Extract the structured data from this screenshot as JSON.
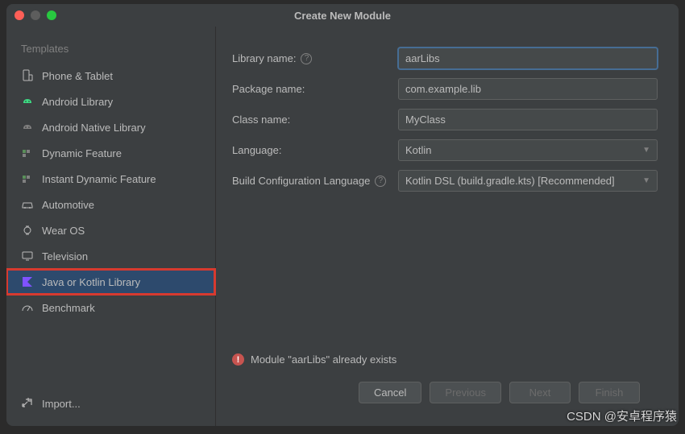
{
  "title": "Create New Module",
  "sidebar": {
    "header": "Templates",
    "items": [
      {
        "label": "Phone & Tablet",
        "icon": "phone"
      },
      {
        "label": "Android Library",
        "icon": "android"
      },
      {
        "label": "Android Native Library",
        "icon": "native"
      },
      {
        "label": "Dynamic Feature",
        "icon": "dynamic"
      },
      {
        "label": "Instant Dynamic Feature",
        "icon": "instant"
      },
      {
        "label": "Automotive",
        "icon": "car"
      },
      {
        "label": "Wear OS",
        "icon": "watch"
      },
      {
        "label": "Television",
        "icon": "tv"
      },
      {
        "label": "Java or Kotlin Library",
        "icon": "kotlin",
        "selected": true
      },
      {
        "label": "Benchmark",
        "icon": "gauge"
      }
    ],
    "import_label": "Import..."
  },
  "form": {
    "library_name": {
      "label": "Library name:",
      "value": "aarLibs",
      "help": true
    },
    "package_name": {
      "label": "Package name:",
      "value": "com.example.lib"
    },
    "class_name": {
      "label": "Class name:",
      "value": "MyClass"
    },
    "language": {
      "label": "Language:",
      "value": "Kotlin"
    },
    "build_config": {
      "label": "Build Configuration Language",
      "value": "Kotlin DSL (build.gradle.kts) [Recommended]",
      "help": true
    }
  },
  "error_message": "Module \"aarLibs\" already exists",
  "footer": {
    "cancel": "Cancel",
    "previous": "Previous",
    "next": "Next",
    "finish": "Finish"
  },
  "watermark": "CSDN @安卓程序猿"
}
